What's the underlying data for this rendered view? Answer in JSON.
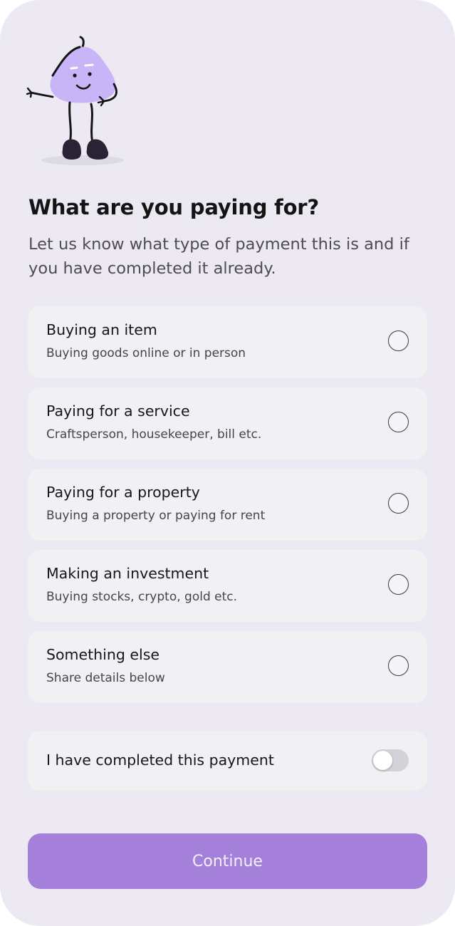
{
  "header": {
    "title": "What are you paying for?",
    "subtitle": "Let us know what type of payment this is and if you have completed it already."
  },
  "options": [
    {
      "title": "Buying an item",
      "description": "Buying goods online or in person",
      "selected": false
    },
    {
      "title": "Paying for a service",
      "description": "Craftsperson, housekeeper, bill etc.",
      "selected": false
    },
    {
      "title": "Paying for a property",
      "description": "Buying a property or paying for rent",
      "selected": false
    },
    {
      "title": "Making an investment",
      "description": "Buying stocks, crypto, gold etc.",
      "selected": false
    },
    {
      "title": "Something else",
      "description": "Share details below",
      "selected": false
    }
  ],
  "completed_toggle": {
    "label": "I have completed this payment",
    "on": false
  },
  "continue_button": {
    "label": "Continue"
  },
  "colors": {
    "background": "#ECE9F3",
    "card": "#F1F1F4",
    "accent": "#A580DB",
    "mascot_body": "#C8B5F8",
    "text": "#17161C"
  },
  "icons": {
    "mascot": "waving-character-illustration",
    "option_control": "radio-circle"
  }
}
